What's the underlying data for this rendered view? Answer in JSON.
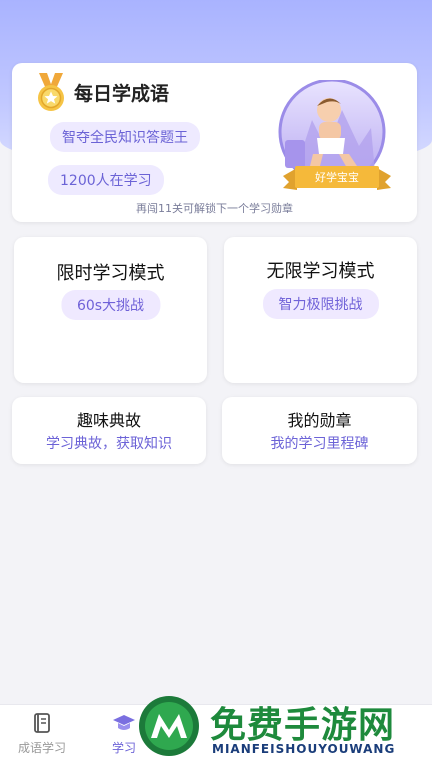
{
  "main": {
    "title": "每日学成语",
    "pill_quiz": "智夺全民知识答题王",
    "pill_learners": "1200人在学习",
    "unlock_tip": "再闯11关可解锁下一个学习勋章",
    "badge_ribbon": "好学宝宝"
  },
  "tiles": {
    "timed": {
      "title": "限时学习模式",
      "pill": "60s大挑战"
    },
    "unlimited": {
      "title": "无限学习模式",
      "pill": "智力极限挑战"
    },
    "stories": {
      "title": "趣味典故",
      "sub": "学习典故，获取知识"
    },
    "medals": {
      "title": "我的勋章",
      "sub": "我的学习里程碑"
    }
  },
  "tabbar": {
    "items": [
      {
        "label": "成语学习",
        "icon": "book-icon"
      },
      {
        "label": "学习",
        "icon": "graduation-cap-icon",
        "active": true
      }
    ]
  },
  "watermark": {
    "text": "免费手游网",
    "sub": "MIANFEISHOUYOUWANG"
  },
  "colors": {
    "accent": "#6c63d7",
    "pill_bg": "#eeeaff",
    "hero_bg": "#a9b3ff",
    "ribbon": "#f5b93a"
  }
}
